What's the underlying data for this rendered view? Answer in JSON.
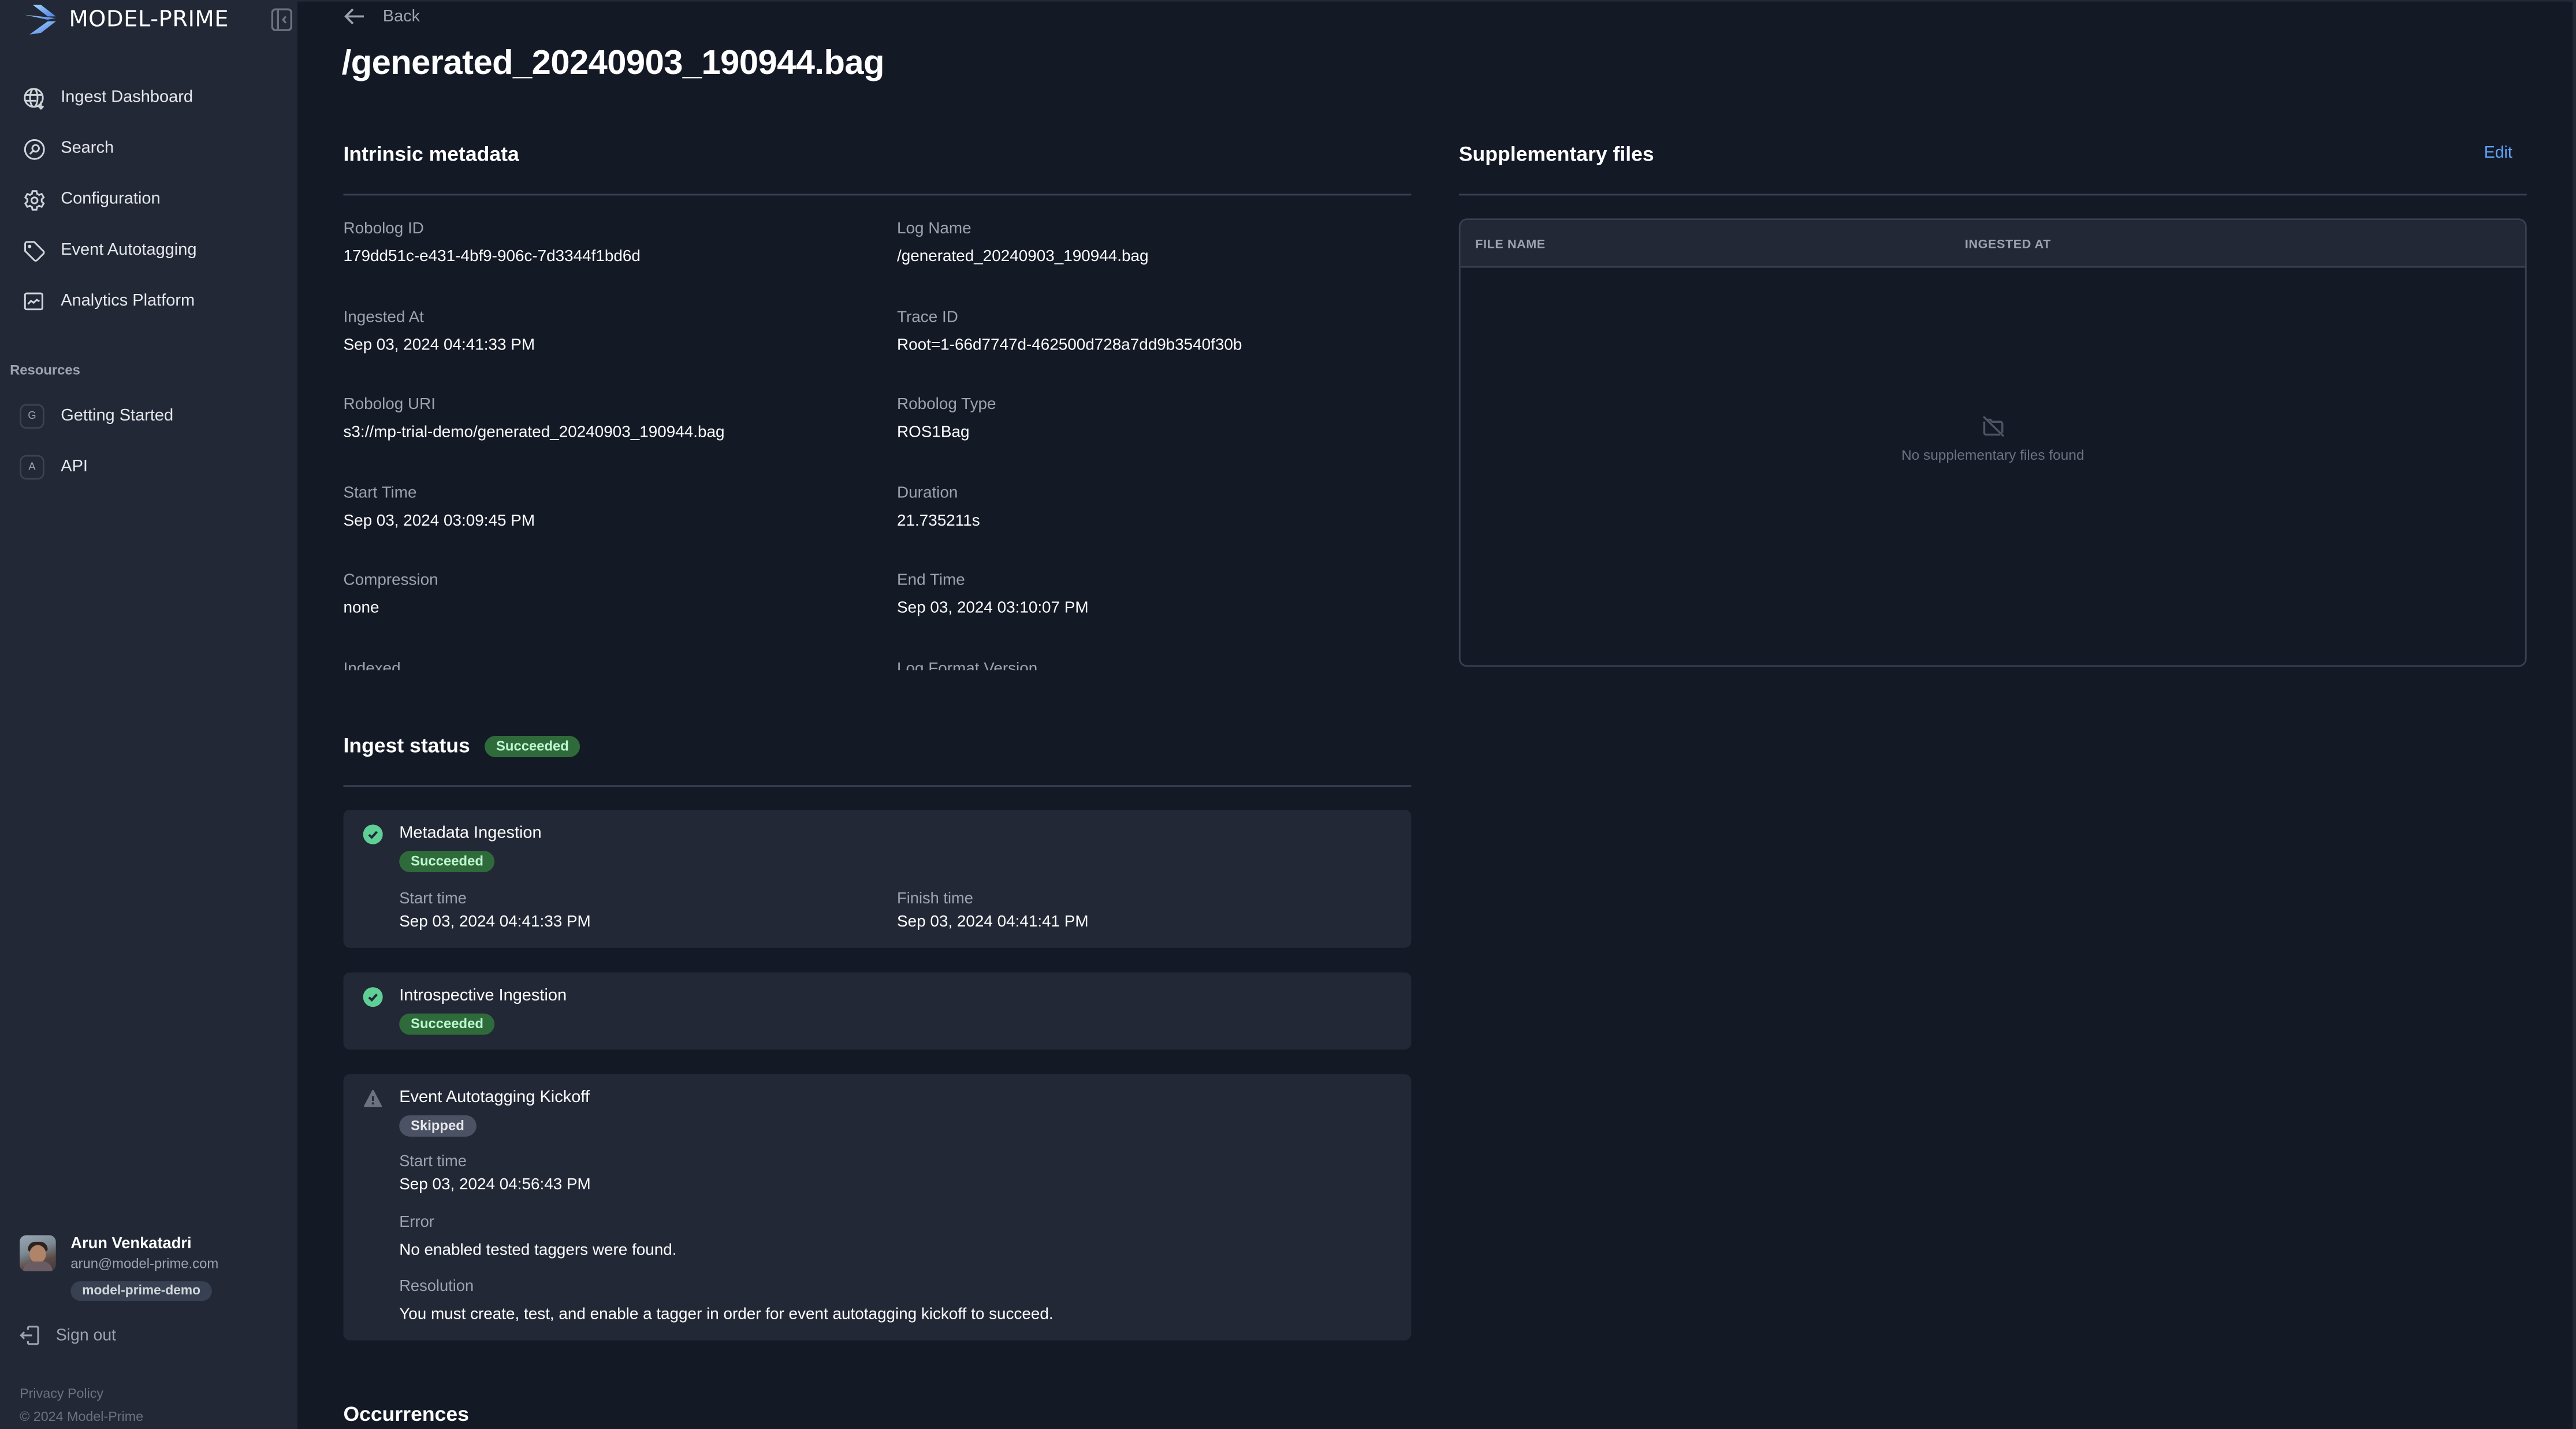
{
  "brand": {
    "name": "MODEL-PRIME",
    "accent": "#60a5fa"
  },
  "sidebar": {
    "collapse_icon": "sidebar-collapse-icon",
    "nav": [
      {
        "label": "Ingest Dashboard",
        "icon": "globe-download-icon"
      },
      {
        "label": "Search",
        "icon": "search-icon"
      },
      {
        "label": "Configuration",
        "icon": "gear-icon"
      },
      {
        "label": "Event Autotagging",
        "icon": "tag-icon"
      },
      {
        "label": "Analytics Platform",
        "icon": "chart-icon"
      }
    ],
    "resources_title": "Resources",
    "resources": [
      {
        "badge": "G",
        "label": "Getting Started"
      },
      {
        "badge": "A",
        "label": "API"
      }
    ],
    "user": {
      "name": "Arun Venkatadri",
      "email": "arun@model-prime.com",
      "org": "model-prime-demo"
    },
    "sign_out": "Sign out",
    "privacy": "Privacy Policy",
    "copyright": "© 2024 Model-Prime"
  },
  "main": {
    "back_label": "Back",
    "title": "/generated_20240903_190944.bag",
    "intrinsic": {
      "heading": "Intrinsic metadata",
      "fields": [
        {
          "label": "Robolog ID",
          "value": "179dd51c-e431-4bf9-906c-7d3344f1bd6d"
        },
        {
          "label": "Log Name",
          "value": "/generated_20240903_190944.bag"
        },
        {
          "label": "Ingested At",
          "value": "Sep 03, 2024 04:41:33 PM"
        },
        {
          "label": "Trace ID",
          "value": "Root=1-66d7747d-462500d728a7dd9b3540f30b"
        },
        {
          "label": "Robolog URI",
          "value": "s3://mp-trial-demo/generated_20240903_190944.bag"
        },
        {
          "label": "Robolog Type",
          "value": "ROS1Bag"
        },
        {
          "label": "Start Time",
          "value": "Sep 03, 2024 03:09:45 PM"
        },
        {
          "label": "Duration",
          "value": "21.735211s"
        },
        {
          "label": "Compression",
          "value": "none"
        },
        {
          "label": "End Time",
          "value": "Sep 03, 2024 03:10:07 PM"
        },
        {
          "label": "Indexed",
          "value": ""
        },
        {
          "label": "Log Format Version",
          "value": ""
        }
      ]
    },
    "supplementary": {
      "heading": "Supplementary files",
      "edit_label": "Edit",
      "columns": [
        "FILE NAME",
        "INGESTED AT"
      ],
      "rows": [],
      "empty_text": "No supplementary files found"
    },
    "ingest_status": {
      "heading": "Ingest status",
      "overall": "Succeeded",
      "steps": [
        {
          "title": "Metadata Ingestion",
          "status": "Succeeded",
          "icon": "check-circle-icon",
          "start_label": "Start time",
          "start": "Sep 03, 2024 04:41:33 PM",
          "finish_label": "Finish time",
          "finish": "Sep 03, 2024 04:41:41 PM"
        },
        {
          "title": "Introspective Ingestion",
          "status": "Succeeded",
          "icon": "check-circle-icon"
        },
        {
          "title": "Event Autotagging Kickoff",
          "status": "Skipped",
          "icon": "warning-icon",
          "start_label": "Start time",
          "start": "Sep 03, 2024 04:56:43 PM",
          "error_label": "Error",
          "error": "No enabled tested taggers were found.",
          "resolution_label": "Resolution",
          "resolution": "You must create, test, and enable a tagger in order for event autotagging kickoff to succeed."
        }
      ]
    },
    "occurrences_heading": "Occurrences"
  },
  "colors": {
    "sidebar_bg": "#222836",
    "main_bg": "#141926",
    "card_bg": "#222836",
    "success_badge_bg": "#2f6a3b",
    "success_badge_text": "#bbf7d0",
    "success_icon": "#5fcf96",
    "skipped_badge_bg": "#4b5263",
    "link": "#60a5fa"
  }
}
